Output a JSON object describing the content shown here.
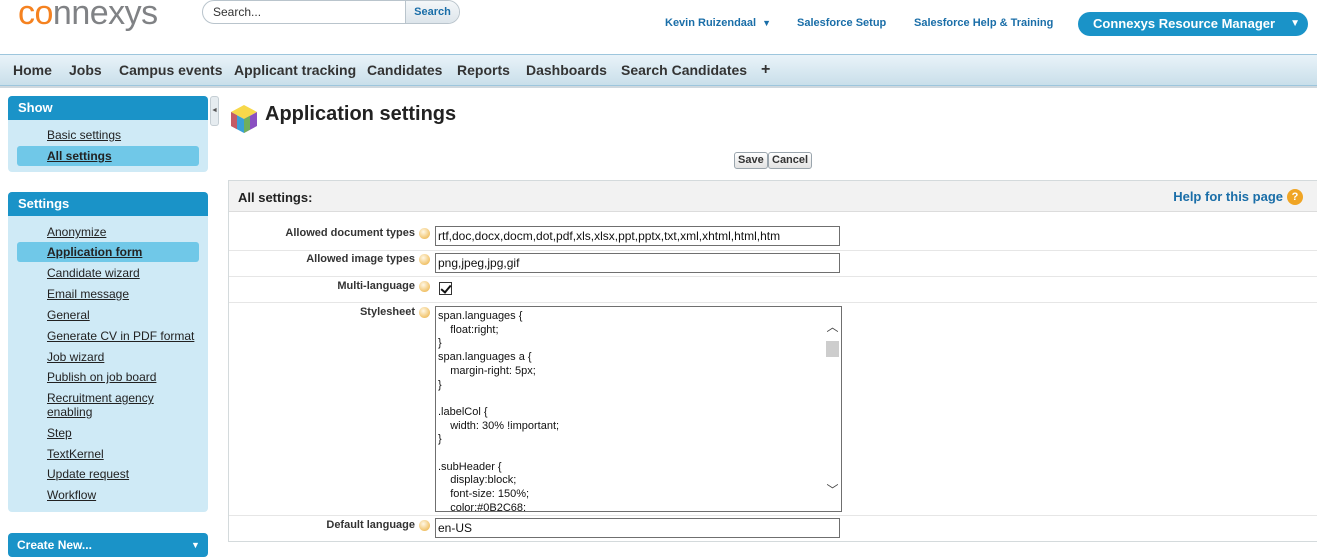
{
  "brand": {
    "logo_accent": "co",
    "logo_rest": "nnexys",
    "accent_color": "#f58220",
    "primary_color": "#1a93c8"
  },
  "search": {
    "placeholder": "Search...",
    "button_label": "Search"
  },
  "top_links": {
    "user_name": "Kevin Ruizendaal",
    "user_caret": "▼",
    "setup": "Salesforce Setup",
    "help_training": "Salesforce Help & Training"
  },
  "app_menu": {
    "label": "Connexys Resource Manager",
    "caret": "▼"
  },
  "tabs": [
    {
      "label": "Home"
    },
    {
      "label": "Jobs"
    },
    {
      "label": "Campus events"
    },
    {
      "label": "Applicant tracking"
    },
    {
      "label": "Candidates"
    },
    {
      "label": "Reports"
    },
    {
      "label": "Dashboards"
    },
    {
      "label": "Search Candidates"
    },
    {
      "label": "+"
    }
  ],
  "sidebar": {
    "collapse_icon": "◄",
    "show": {
      "title": "Show",
      "items": [
        {
          "label": "Basic settings",
          "active": false
        },
        {
          "label": "All settings",
          "active": true
        }
      ]
    },
    "settings": {
      "title": "Settings",
      "items": [
        {
          "label": "Anonymize",
          "active": false
        },
        {
          "label": "Application form",
          "active": true
        },
        {
          "label": "Candidate wizard",
          "active": false
        },
        {
          "label": "Email message",
          "active": false
        },
        {
          "label": "General",
          "active": false
        },
        {
          "label": "Generate CV in PDF format",
          "active": false
        },
        {
          "label": "Job wizard",
          "active": false
        },
        {
          "label": "Publish on job board",
          "active": false
        },
        {
          "label": "Recruitment agency enabling",
          "active": false
        },
        {
          "label": "Step",
          "active": false
        },
        {
          "label": "TextKernel",
          "active": false
        },
        {
          "label": "Update request",
          "active": false
        },
        {
          "label": "Workflow",
          "active": false
        }
      ]
    },
    "create_new": "Create New...",
    "create_new_caret": "▼"
  },
  "page": {
    "title": "Application settings",
    "save_label": "Save",
    "cancel_label": "Cancel"
  },
  "panel": {
    "title": "All settings:",
    "help_link": "Help for this page",
    "help_icon": "?",
    "fields": {
      "allowed_document_types": {
        "label": "Allowed document types",
        "value": "rtf,doc,docx,docm,dot,pdf,xls,xlsx,ppt,pptx,txt,xml,xhtml,html,htm"
      },
      "allowed_image_types": {
        "label": "Allowed image types",
        "value": "png,jpeg,jpg,gif"
      },
      "multi_language": {
        "label": "Multi-language",
        "checked": true
      },
      "stylesheet": {
        "label": "Stylesheet",
        "value": "span.languages {\n\tfloat:right;\n}\nspan.languages a {\n\tmargin-right: 5px;\n}\n\n.labelCol {\n\twidth: 30% !important;\n}\n\n.subHeader {\n\tdisplay:block;\n\tfont-size: 150%;\n\tcolor:#0B2C68;"
      },
      "default_language": {
        "label": "Default language",
        "value": "en-US"
      }
    },
    "scroll_up_icon": "︿",
    "scroll_down_icon": "﹀"
  }
}
